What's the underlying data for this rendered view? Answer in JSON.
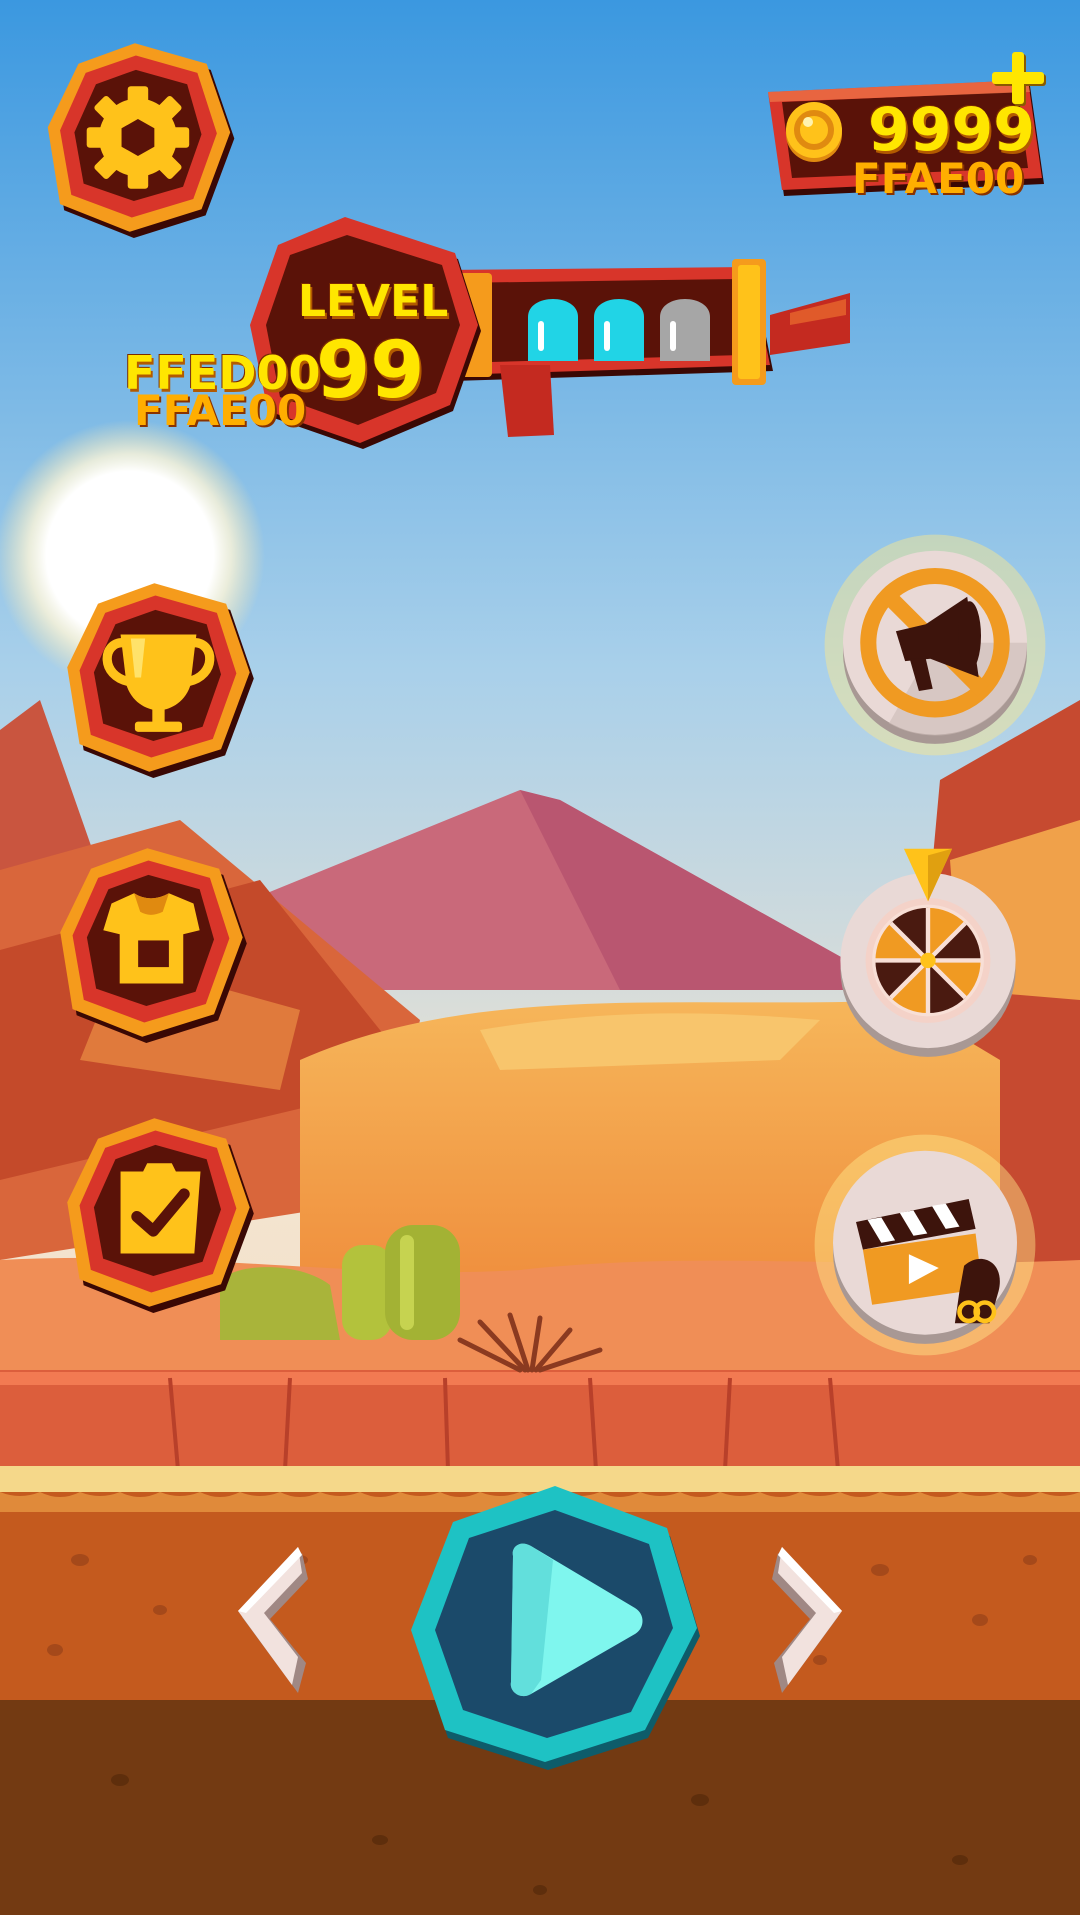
{
  "hud": {
    "coins": "9999",
    "coins_tag": "FFAE00",
    "add_coins_symbol": "+",
    "level_label": "LEVEL",
    "level_number": "99",
    "level_tag_top": "FFED00",
    "level_tag_bottom": "FFAE00",
    "ammo_total": 3,
    "ammo_filled": 2
  },
  "menu": {
    "left": [
      {
        "icon": "gear-icon"
      },
      {
        "icon": "trophy-icon"
      },
      {
        "icon": "shirt-icon"
      },
      {
        "icon": "clipboard-check-icon"
      }
    ],
    "right": [
      {
        "icon": "no-ads-megaphone-icon"
      },
      {
        "icon": "lucky-wheel-icon"
      },
      {
        "icon": "clapperboard-key-icon"
      }
    ]
  },
  "nav": {
    "prev": "chevron-left-icon",
    "play": "play-icon",
    "next": "chevron-right-icon"
  },
  "colors": {
    "sky_top": "#3b98e0",
    "sky_bottom": "#f3e4d0",
    "badge_dark": "#5a1208",
    "badge_ring": "#d8352a",
    "badge_rim": "#f59b1c",
    "icon_gold": "#ffc21a",
    "play_teal": "#1ec2c4",
    "play_dark": "#1b4a6a",
    "play_light": "#7ff6ee",
    "ammo_cyan": "#21d4e6",
    "ammo_grey": "#a6a6a6",
    "ground_orange": "#c45a1e",
    "ground_brown": "#733a12"
  }
}
